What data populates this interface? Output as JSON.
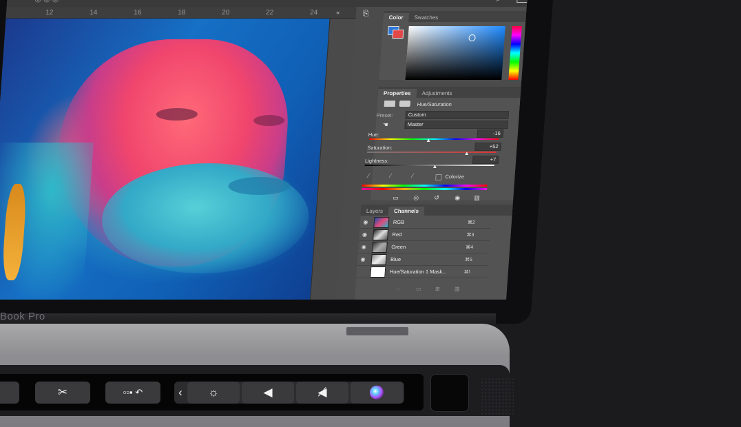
{
  "laptop": {
    "model_label": "Book Pro"
  },
  "ruler": {
    "ticks": [
      "12",
      "14",
      "16",
      "18",
      "20",
      "22",
      "24"
    ]
  },
  "color_panel": {
    "tabs": [
      "Color",
      "Swatches"
    ],
    "active_tab": "Color"
  },
  "properties_panel": {
    "tabs": [
      "Properties",
      "Adjustments"
    ],
    "active_tab": "Properties",
    "adjustment_title": "Hue/Saturation",
    "preset_label": "Preset:",
    "preset_value": "Custom",
    "channel_value": "Master",
    "hue_label": "Hue:",
    "hue_value": "-16",
    "saturation_label": "Saturation:",
    "saturation_value": "+52",
    "lightness_label": "Lightness:",
    "lightness_value": "+7",
    "colorize_label": "Colorize"
  },
  "layers_panel": {
    "tabs": [
      "Layers",
      "Channels"
    ],
    "active_tab": "Channels",
    "channels": [
      {
        "name": "RGB",
        "shortcut": "⌘2"
      },
      {
        "name": "Red",
        "shortcut": "⌘3"
      },
      {
        "name": "Green",
        "shortcut": "⌘4"
      },
      {
        "name": "Blue",
        "shortcut": "⌘5"
      },
      {
        "name": "Hue/Saturation 1 Mask...",
        "shortcut": "⌘\\"
      }
    ]
  },
  "touchbar": {
    "icons": [
      "scissors-icon",
      "undo-icon",
      "chevron-left-icon",
      "brightness-icon",
      "volume-icon",
      "mute-icon",
      "siri-icon"
    ]
  },
  "colors": {
    "ps_panel": "#535353",
    "ps_dark": "#3a3a3a",
    "touchbar_key": "#3a3a3d",
    "laptop_silver": "#9a9a9d"
  }
}
